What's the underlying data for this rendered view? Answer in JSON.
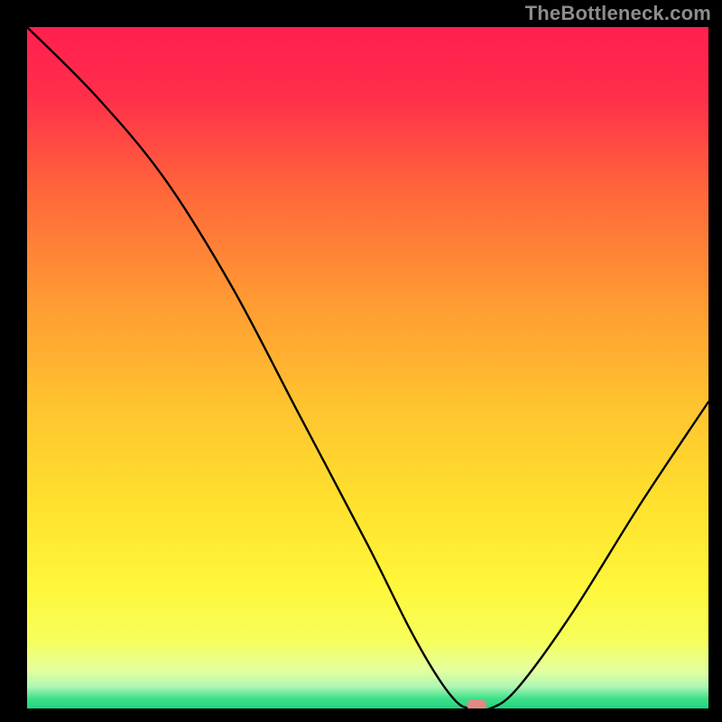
{
  "watermark": "TheBottleneck.com",
  "chart_data": {
    "type": "line",
    "title": "",
    "xlabel": "",
    "ylabel": "",
    "xlim": [
      0,
      100
    ],
    "ylim": [
      0,
      100
    ],
    "grid": false,
    "legend": false,
    "background": {
      "type": "vertical-gradient",
      "stops": [
        {
          "pos": 0.0,
          "color": "#ff1f4f"
        },
        {
          "pos": 0.1,
          "color": "#ff2e4a"
        },
        {
          "pos": 0.25,
          "color": "#ff6a3a"
        },
        {
          "pos": 0.4,
          "color": "#ff9a33"
        },
        {
          "pos": 0.55,
          "color": "#ffc22f"
        },
        {
          "pos": 0.7,
          "color": "#ffe12e"
        },
        {
          "pos": 0.82,
          "color": "#fff63a"
        },
        {
          "pos": 0.9,
          "color": "#f6ff5b"
        },
        {
          "pos": 0.945,
          "color": "#e3ffa0"
        },
        {
          "pos": 0.968,
          "color": "#aef7b3"
        },
        {
          "pos": 0.985,
          "color": "#41e08b"
        },
        {
          "pos": 1.0,
          "color": "#1ed47f"
        }
      ]
    },
    "series": [
      {
        "name": "bottleneck-curve",
        "color": "#000000",
        "x": [
          0,
          10,
          20,
          30,
          40,
          50,
          56,
          60,
          63,
          65,
          68,
          72,
          80,
          90,
          100
        ],
        "y": [
          100,
          90,
          78,
          62,
          43,
          24,
          12,
          5,
          1,
          0,
          0,
          3,
          14,
          30,
          45
        ]
      }
    ],
    "marker": {
      "name": "optimal-point",
      "x": 66,
      "y": 0.5,
      "color": "#e08a84",
      "shape": "rounded-capsule"
    }
  }
}
